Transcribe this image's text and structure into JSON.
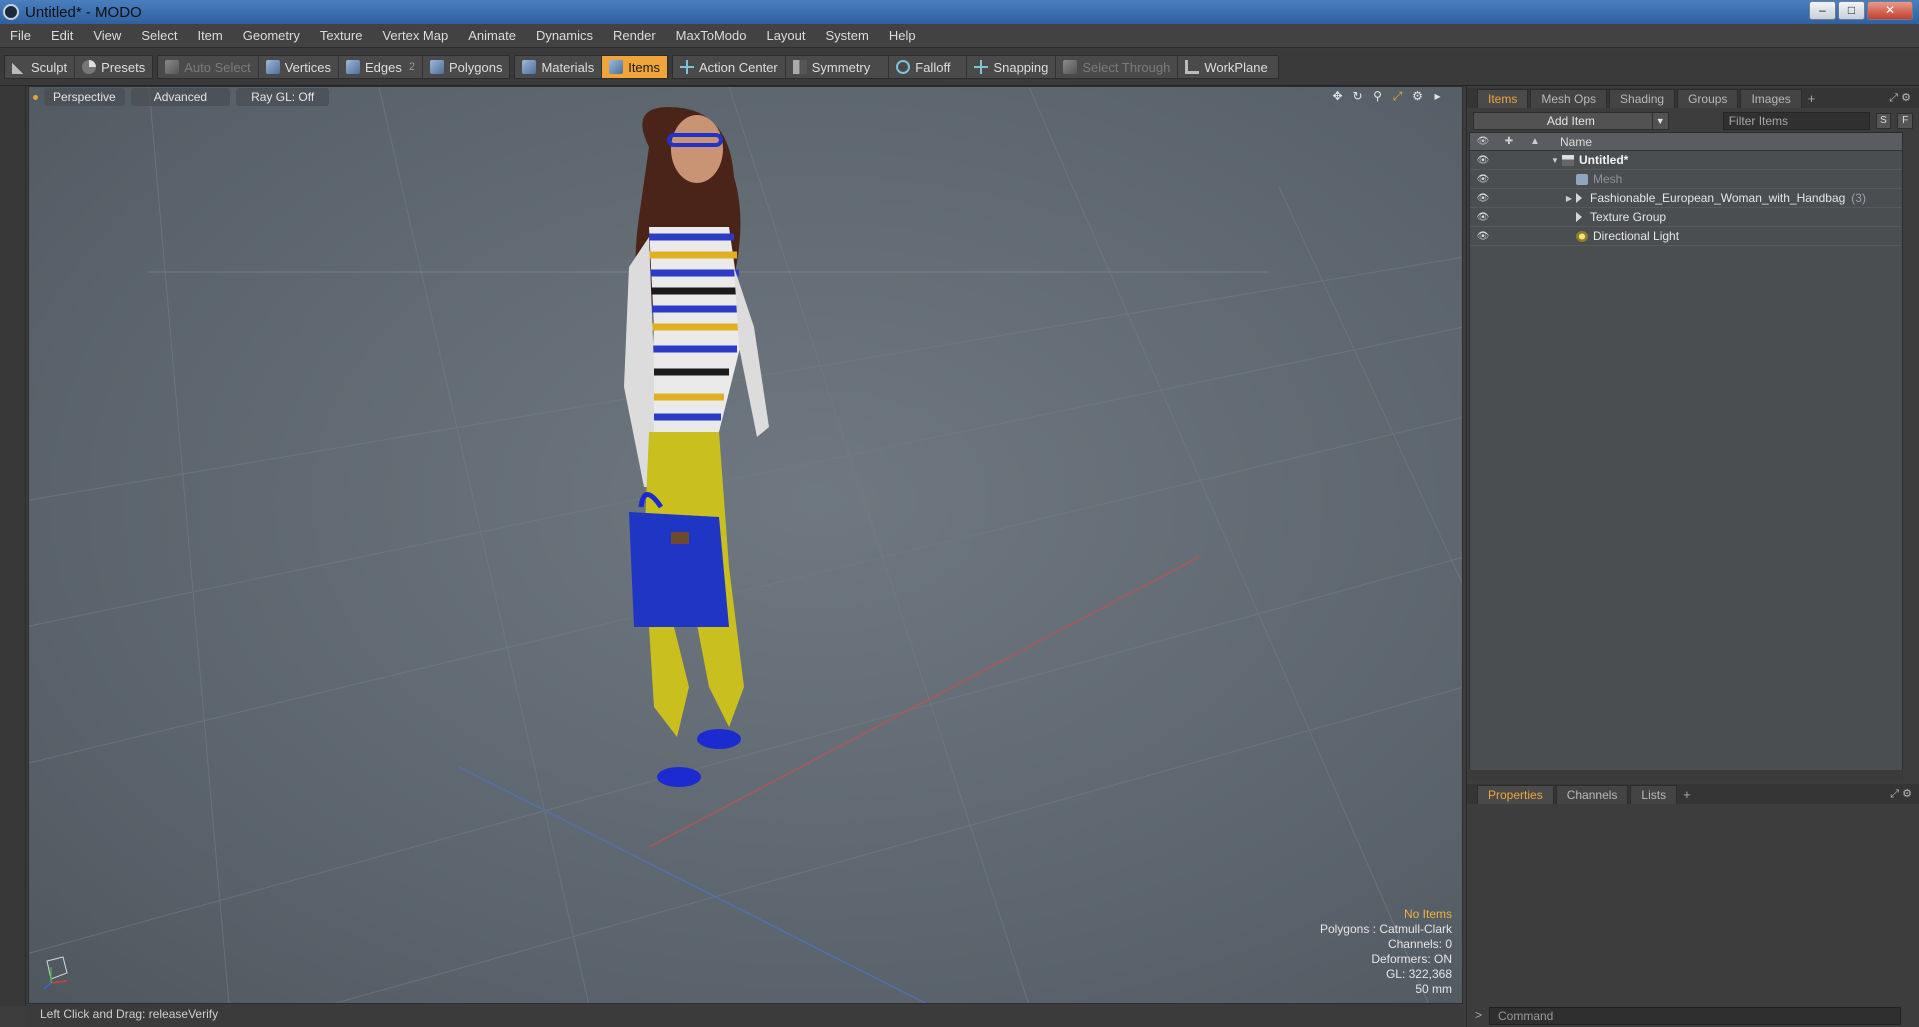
{
  "window": {
    "title": "Untitled* - MODO",
    "min": "–",
    "max": "□",
    "close": "✕"
  },
  "menu": [
    "File",
    "Edit",
    "View",
    "Select",
    "Item",
    "Geometry",
    "Texture",
    "Vertex Map",
    "Animate",
    "Dynamics",
    "Render",
    "MaxToModo",
    "Layout",
    "System",
    "Help"
  ],
  "toolbar": {
    "sculpt": "Sculpt",
    "presets": "Presets",
    "auto_select": "Auto Select",
    "vertices": "Vertices",
    "edges": "Edges",
    "edges_badge": "2",
    "polygons": "Polygons",
    "materials": "Materials",
    "items": "Items",
    "action_center": "Action Center",
    "symmetry": "Symmetry",
    "falloff": "Falloff",
    "snapping": "Snapping",
    "select_through": "Select Through",
    "workplane": "WorkPlane"
  },
  "viewport": {
    "tabs": {
      "perspective": "Perspective",
      "advanced": "Advanced",
      "raygl": "Ray GL: Off"
    },
    "info": {
      "no_items": "No Items",
      "polygons": "Polygons : Catmull-Clark",
      "channels": "Channels: 0",
      "deformers": "Deformers: ON",
      "gl": "GL: 322,368",
      "lens": "50 mm"
    },
    "status": "Left Click and Drag:  releaseVerify"
  },
  "right_panel": {
    "tabs": [
      "Items",
      "Mesh Ops",
      "Shading",
      "Groups",
      "Images"
    ],
    "add_item": "Add Item",
    "filter_placeholder": "Filter Items",
    "btn_s": "S",
    "btn_f": "F",
    "column_name": "Name",
    "tree": [
      {
        "label": "Untitled*",
        "icon": "scene-icon"
      },
      {
        "label": "Mesh",
        "icon": "mesh-icon"
      },
      {
        "label": "Fashionable_European_Woman_with_Handbag",
        "count": "(3)",
        "icon": "group-icon"
      },
      {
        "label": "Texture Group",
        "icon": "group-icon"
      },
      {
        "label": "Directional Light",
        "icon": "light-icon"
      }
    ],
    "bottom_tabs": [
      "Properties",
      "Channels",
      "Lists"
    ],
    "command_placeholder": "Command"
  },
  "colors": {
    "accent": "#f0a53a",
    "viewport_bg": "#626b73"
  }
}
